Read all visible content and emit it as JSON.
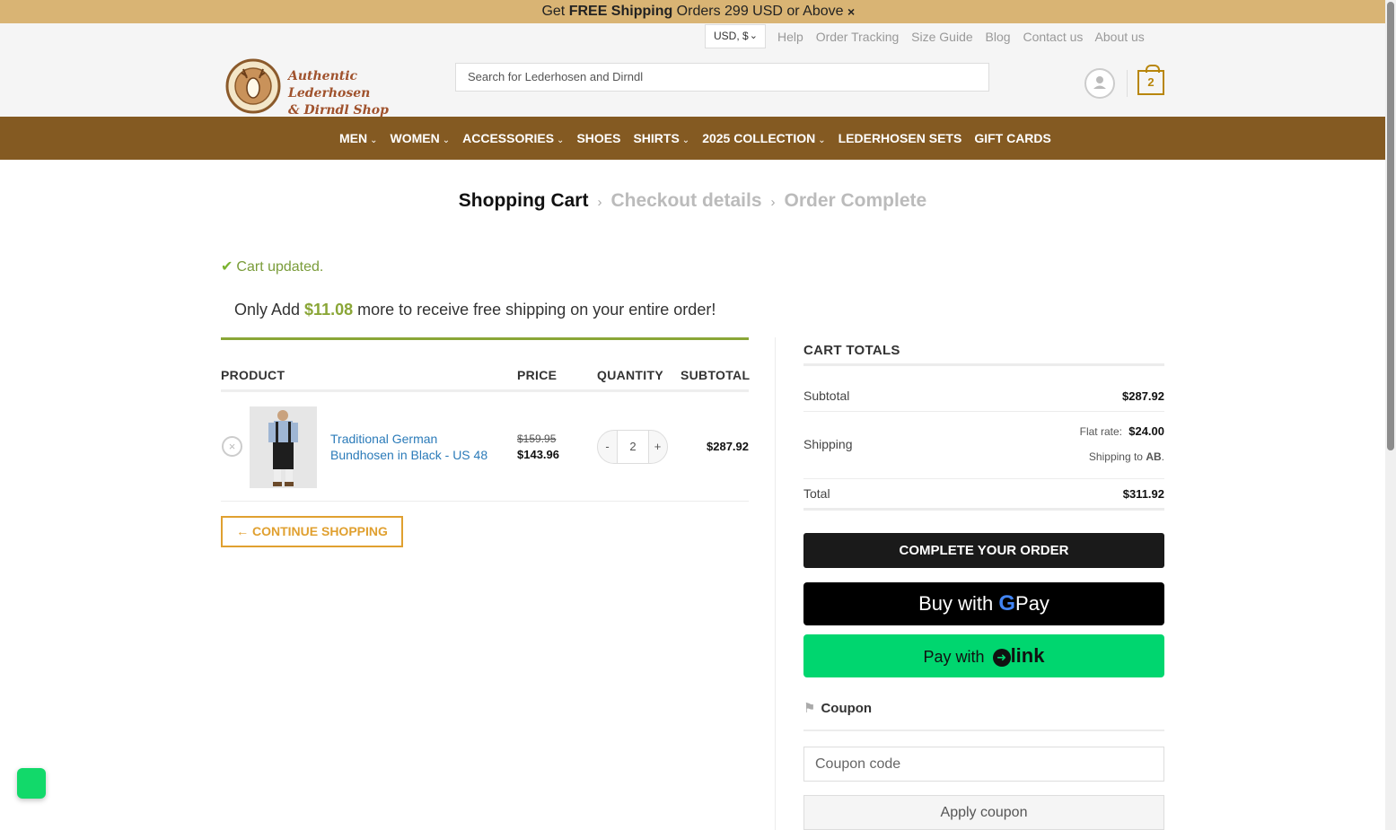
{
  "announcement": {
    "prefix": "Get ",
    "bold": "FREE Shipping",
    "suffix": " Orders 299 USD or Above",
    "close": "×"
  },
  "header": {
    "currency": "USD, $",
    "links": [
      "Help",
      "Order Tracking",
      "Size Guide",
      "Blog",
      "Contact us",
      "About us"
    ],
    "logo_line1": "Authentic Lederhosen",
    "logo_line2": "& Dirndl Shop",
    "search_placeholder": "Search for Lederhosen and Dirndl",
    "cart_count": "2"
  },
  "nav": [
    {
      "label": "MEN",
      "caret": true
    },
    {
      "label": "WOMEN",
      "caret": true
    },
    {
      "label": "ACCESSORIES",
      "caret": true
    },
    {
      "label": "SHOES",
      "caret": false
    },
    {
      "label": "SHIRTS",
      "caret": true
    },
    {
      "label": "2025 COLLECTION",
      "caret": true
    },
    {
      "label": "LEDERHOSEN SETS",
      "caret": false
    },
    {
      "label": "GIFT CARDS",
      "caret": false
    }
  ],
  "breadcrumb": {
    "step1": "Shopping Cart",
    "step2": "Checkout details",
    "step3": "Order Complete"
  },
  "notice": "Cart updated.",
  "freeship": {
    "prefix": "Only Add ",
    "amount": "$11.08",
    "suffix": " more to receive free shipping on your entire order!"
  },
  "table": {
    "headers": {
      "product": "PRODUCT",
      "price": "PRICE",
      "quantity": "QUANTITY",
      "subtotal": "SUBTOTAL"
    },
    "rows": [
      {
        "name": "Traditional German Bundhosen in Black - US 48",
        "old_price": "$159.95",
        "price": "$143.96",
        "qty": "2",
        "subtotal": "$287.92"
      }
    ]
  },
  "continue_label": "← CONTINUE SHOPPING",
  "totals": {
    "heading": "CART TOTALS",
    "subtotal_label": "Subtotal",
    "subtotal": "$287.92",
    "shipping_label": "Shipping",
    "flat_rate_label": "Flat rate:",
    "flat_rate": "$24.00",
    "shipping_to": "Shipping to",
    "shipping_to_code": "AB",
    "total_label": "Total",
    "total": "$311.92"
  },
  "buttons": {
    "complete": "COMPLETE YOUR ORDER",
    "gpay_prefix": "Buy with",
    "gpay_brand": "Pay",
    "link_prefix": "Pay with",
    "link_brand": "link"
  },
  "coupon": {
    "heading": "Coupon",
    "placeholder": "Coupon code",
    "apply": "Apply coupon"
  },
  "colors": {
    "announcement": "#d9b474",
    "nav": "#845a22",
    "accent": "#e0a030",
    "green": "#8aa637",
    "link_green": "#00d66f"
  }
}
